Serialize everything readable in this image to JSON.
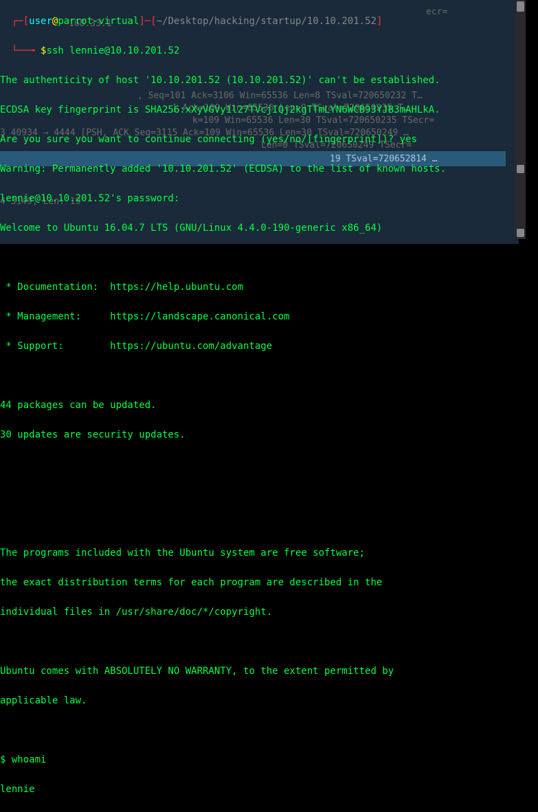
{
  "prompt": {
    "bracket_open": "[",
    "user": "user",
    "at": "@",
    "host": "parrot-virtual",
    "bracket_close": "]",
    "dash": "─",
    "path_bracket_open": "[",
    "path": "~/Desktop/hacking/startup/10.10.201.52",
    "path_bracket_close": "]",
    "dollar": "$"
  },
  "command": "ssh lennie@10.10.201.52",
  "output": {
    "line1": "The authenticity of host '10.10.201.52 (10.10.201.52)' can't be established.",
    "line2": "ECDSA key fingerprint is SHA256:xXyVGVy1l27TVcjIQj2kgTTmLYN6WCB93YJB3mAHLkA.",
    "line3": "Are you sure you want to continue connecting (yes/no/[fingerprint])? yes",
    "line4": "Warning: Permanently added '10.10.201.52' (ECDSA) to the list of known hosts.",
    "line5": "lennie@10.10.201.52's password:",
    "line6": "Welcome to Ubuntu 16.04.7 LTS (GNU/Linux 4.4.0-190-generic x86_64)",
    "line7": "",
    "line8": " * Documentation:  https://help.ubuntu.com",
    "line9": " * Management:     https://landscape.canonical.com",
    "line10": " * Support:        https://ubuntu.com/advantage",
    "line11": "",
    "line12": "44 packages can be updated.",
    "line13": "30 updates are security updates.",
    "line14": "",
    "line15": "",
    "line16": "",
    "line17": "The programs included with the Ubuntu system are free software;",
    "line18": "the exact distribution terms for each program are described in the",
    "line19": "individual files in /usr/share/doc/*/copyright.",
    "line20": "",
    "line21": "Ubuntu comes with ABSOLUTELY NO WARRANTY, to the extent permitted by",
    "line22": "applicable law.",
    "line23": "",
    "line24": "$ whoami",
    "line25": "lennie"
  },
  "bg": {
    "l1": "ecr=",
    "l2": "168.33.1",
    "l3": ", Seq=101 Ack=3106 Win=65536 Len=8 TSval=720650232 T…",
    "l4": "] Ack=109 Win=65536 Len=9 TSval=720650235 T…",
    "l5": "k=109 Win=65536 Len=30 TSval=720650235 TSecr=",
    "l6": "3 40934 → 4444 [PSH, ACK Seq=3115 Ack=109 Win=65536 Len=30 TSval=720650249 …",
    "l7": " Len=0 TSval=720650249 TSecr=",
    "l8": "19 TSval=720652814 …",
    "l9": "",
    "l10": "4 3149, Len: 19"
  }
}
